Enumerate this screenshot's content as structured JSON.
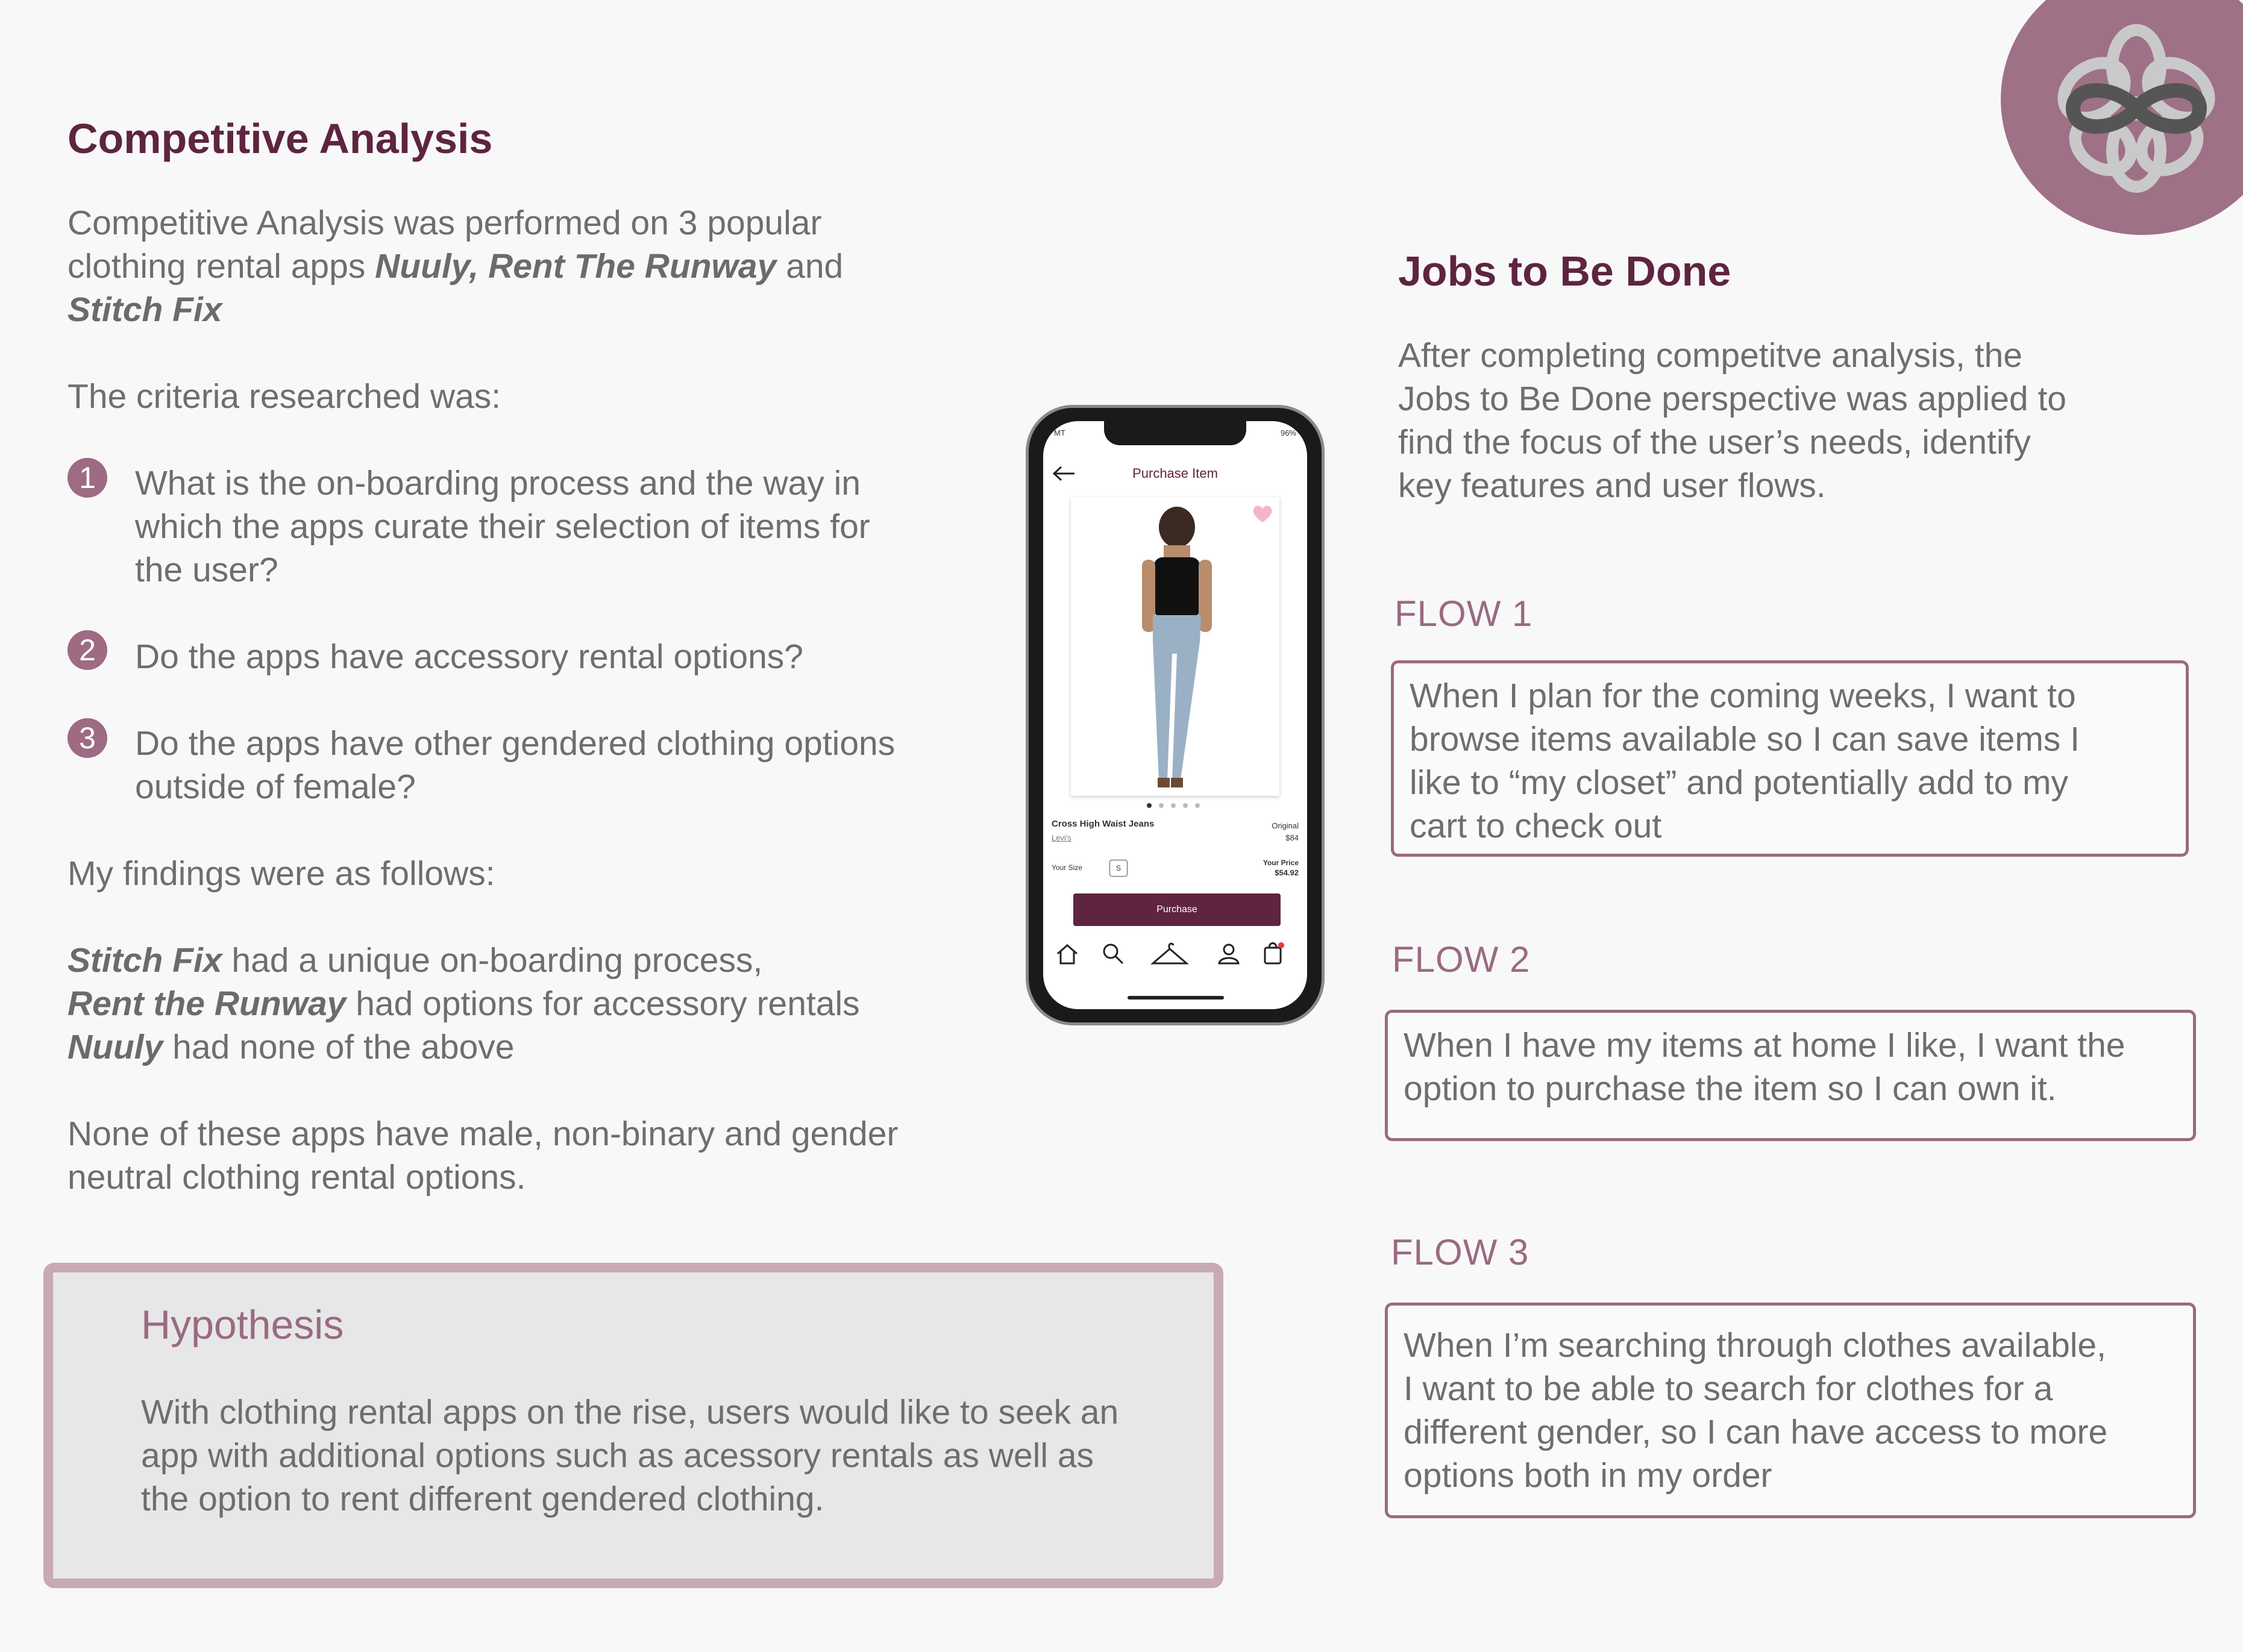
{
  "left": {
    "title": "Competitive Analysis",
    "intro_1": "Competitive Analysis was performed on 3 popular",
    "intro_2a": "clothing rental apps ",
    "intro_2b": "Nuuly, Rent The Runway",
    "intro_2c": " and",
    "intro_3": "Stitch Fix",
    "criteria_heading": "The criteria researched was:",
    "criteria": [
      {
        "num": "1",
        "lines": [
          "What is the on-boarding process and the way in",
          "which the apps curate their selection of items for",
          "the user?"
        ]
      },
      {
        "num": "2",
        "lines": [
          "Do the apps have accessory rental options?"
        ]
      },
      {
        "num": "3",
        "lines": [
          "Do the apps have other gendered clothing options",
          "outside of female?"
        ]
      }
    ],
    "findings_heading": "My findings were as follows:",
    "findings": [
      {
        "bold": "Stitch Fix",
        "text": " had a unique on-boarding process,"
      },
      {
        "bold": "Rent the Runway",
        "text": " had options for accessory rentals"
      },
      {
        "bold": "Nuuly",
        "text": " had none of the above"
      }
    ],
    "conclusion_1": "None of these apps have male, non-binary and gender",
    "conclusion_2": "neutral clothing rental options."
  },
  "hypothesis": {
    "title": "Hypothesis",
    "lines": [
      "With clothing rental apps on the rise, users would like to seek an",
      "app with additional options such as acessory rentals as well as",
      "the option to rent different gendered clothing."
    ]
  },
  "right": {
    "title": "Jobs to Be Done",
    "intro_lines": [
      "After completing competitve analysis, the",
      "Jobs to Be Done perspective was applied to",
      "find the focus of the user’s needs, identify",
      "key features and user flows."
    ],
    "flows": [
      {
        "label": "FLOW 1",
        "lines": [
          "When I plan for the coming weeks, I want to",
          "browse items available so I can save items I",
          "like to “my closet” and potentially add to my",
          "cart to check out"
        ]
      },
      {
        "label": "FLOW 2",
        "lines": [
          "When I have my items at home I like, I want the",
          "option to purchase the item so I can own it."
        ]
      },
      {
        "label": "FLOW 3",
        "lines": [
          "When I’m searching through clothes available,",
          "I want to be able to search for clothes for a",
          "different gender, so I can have access to more",
          "options both in my order"
        ]
      }
    ]
  },
  "phone": {
    "carrier": "MT",
    "battery": "96%",
    "header_title": "Purchase Item",
    "product_name": "Cross High Waist Jeans",
    "brand": "Levi's",
    "original_label": "Original",
    "original_price": "$84",
    "size_label": "Your Size",
    "size_value": "S",
    "your_price_label": "Your Price",
    "your_price": "$54.92",
    "purchase_button": "Purchase"
  },
  "colors": {
    "accent": "#5e2440",
    "mauve": "#9a6a82",
    "logo_circle": "#9e7186"
  },
  "icons": [
    "back-arrow-icon",
    "heart-icon",
    "home-icon",
    "search-icon",
    "hanger-icon",
    "profile-icon",
    "bag-icon",
    "flower-logo-icon"
  ]
}
